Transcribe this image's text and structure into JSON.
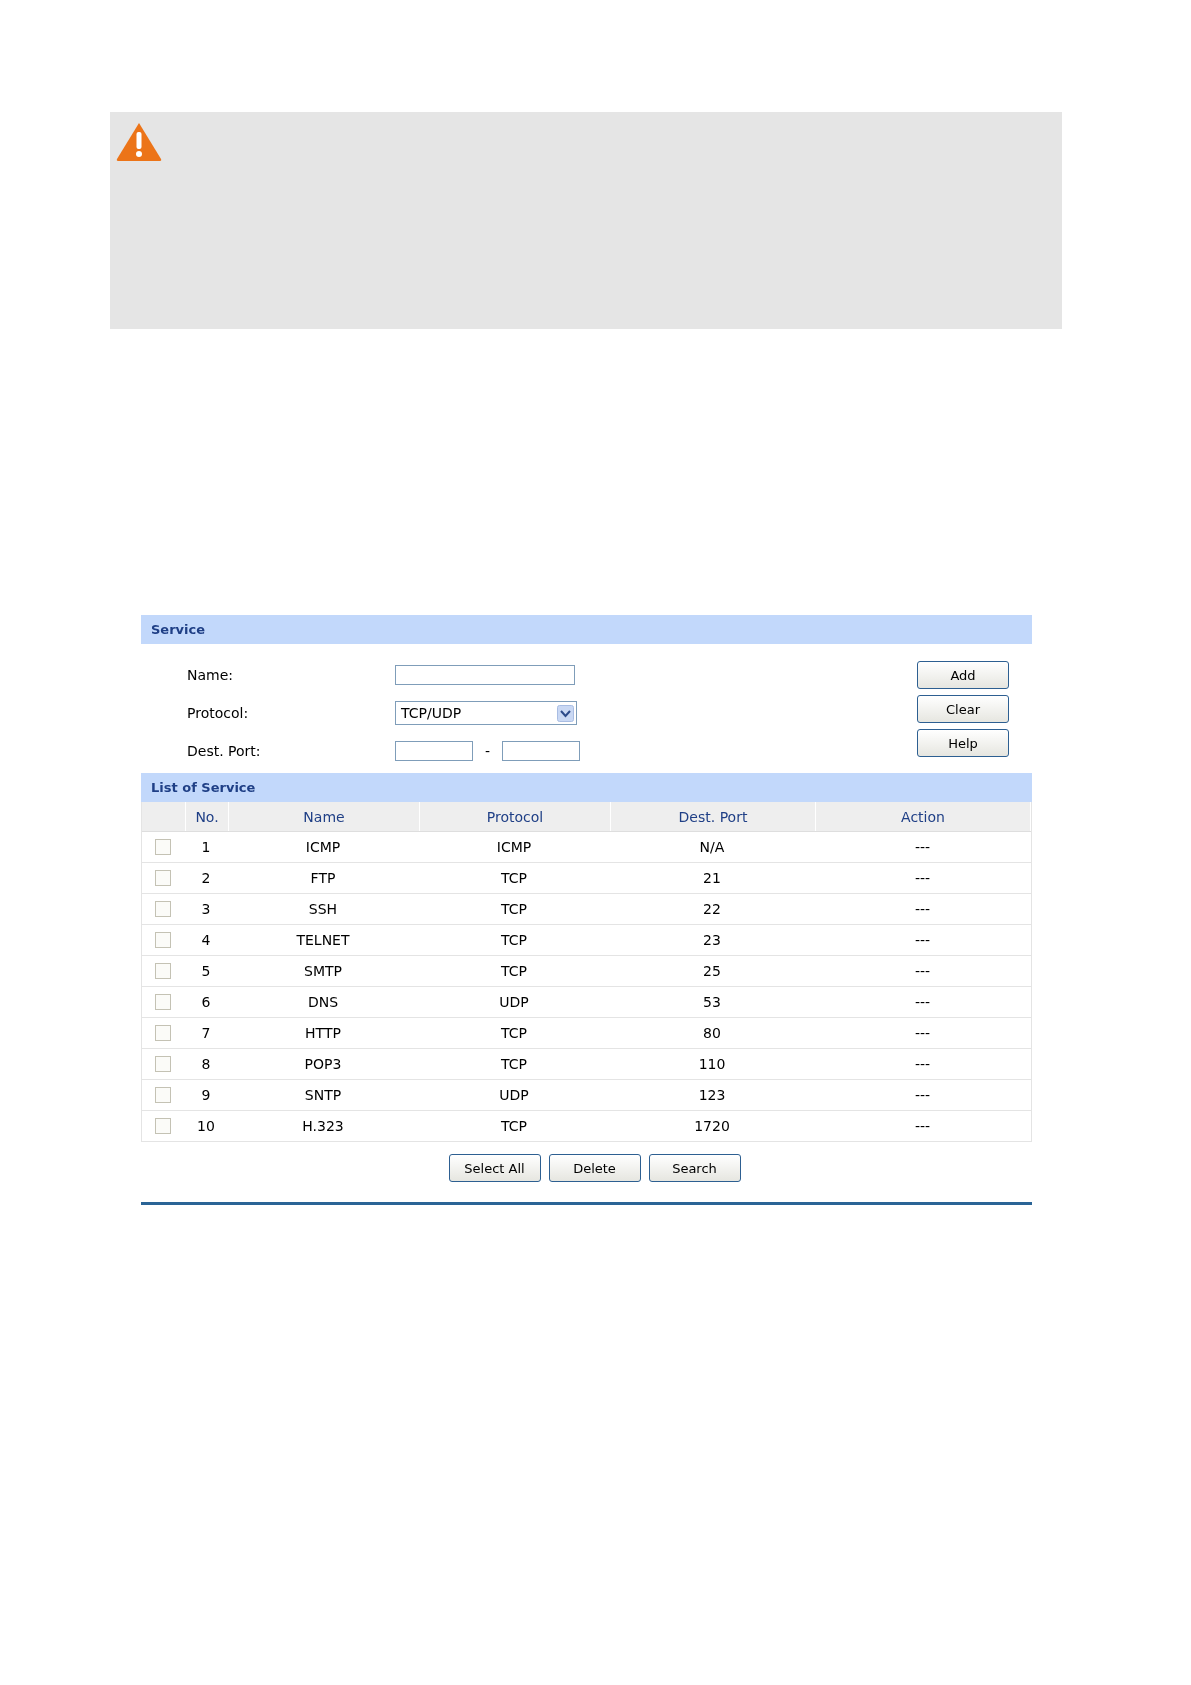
{
  "note": {
    "kind": "warning"
  },
  "service": {
    "title": "Service",
    "fields": [
      {
        "label": "Name:",
        "kind": "text"
      },
      {
        "label": "Protocol:",
        "kind": "select",
        "value": "TCP/UDP"
      },
      {
        "label": "Dest. Port:",
        "kind": "range",
        "separator": "-"
      }
    ],
    "buttons": [
      "Add",
      "Clear",
      "Help"
    ]
  },
  "list": {
    "title": "List of Service",
    "columns": [
      "No.",
      "Name",
      "Protocol",
      "Dest. Port",
      "Action"
    ],
    "rows": [
      {
        "checked": false,
        "cells": [
          "1",
          "ICMP",
          "ICMP",
          "N/A",
          "---"
        ]
      },
      {
        "checked": false,
        "cells": [
          "2",
          "FTP",
          "TCP",
          "21",
          "---"
        ]
      },
      {
        "checked": false,
        "cells": [
          "3",
          "SSH",
          "TCP",
          "22",
          "---"
        ]
      },
      {
        "checked": false,
        "cells": [
          "4",
          "TELNET",
          "TCP",
          "23",
          "---"
        ]
      },
      {
        "checked": false,
        "cells": [
          "5",
          "SMTP",
          "TCP",
          "25",
          "---"
        ]
      },
      {
        "checked": false,
        "cells": [
          "6",
          "DNS",
          "UDP",
          "53",
          "---"
        ]
      },
      {
        "checked": false,
        "cells": [
          "7",
          "HTTP",
          "TCP",
          "80",
          "---"
        ]
      },
      {
        "checked": false,
        "cells": [
          "8",
          "POP3",
          "TCP",
          "110",
          "---"
        ]
      },
      {
        "checked": false,
        "cells": [
          "9",
          "SNTP",
          "UDP",
          "123",
          "---"
        ]
      },
      {
        "checked": false,
        "cells": [
          "10",
          "H.323",
          "TCP",
          "1720",
          "---"
        ]
      }
    ],
    "buttons": [
      "Select All",
      "Delete",
      "Search"
    ]
  }
}
